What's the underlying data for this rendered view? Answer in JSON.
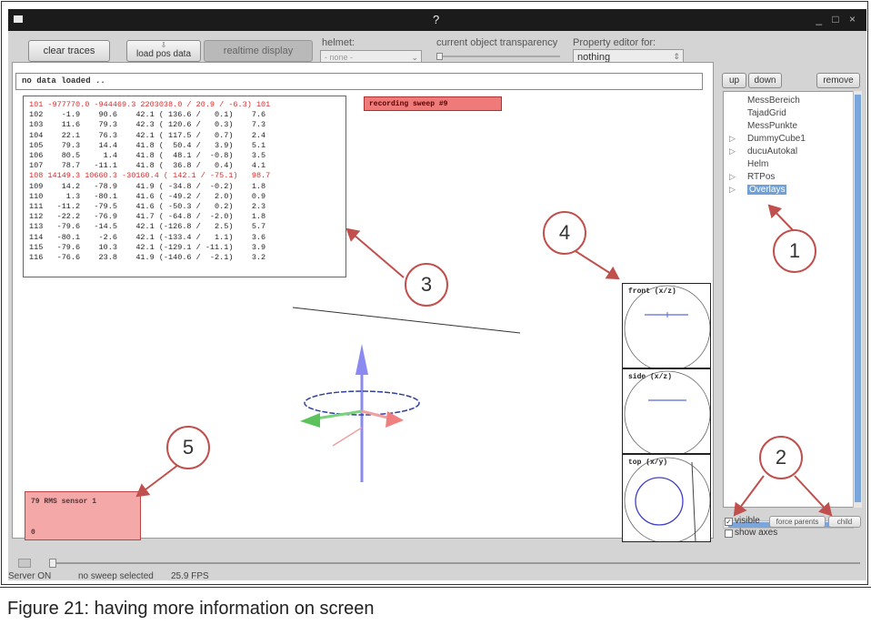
{
  "window": {
    "title": "?",
    "controls": "_ □ ×"
  },
  "toolbar": {
    "clear_traces": "clear traces",
    "load_pos_data": "load pos data",
    "realtime_display": "realtime display",
    "helmet_label": "helmet:",
    "helmet_value": "- none -",
    "transparency_label": "current object transparency",
    "property_editor_label": "Property editor for:",
    "property_editor_value": "nothing"
  },
  "viewport": {
    "message": "no data loaded ..",
    "recording": "recording sweep #9",
    "sensor_label": "79   RMS sensor 1",
    "sensor_value": "0",
    "projections": [
      {
        "title": "front (x/z)"
      },
      {
        "title": "side (x/z)"
      },
      {
        "title": "top (x/y)"
      }
    ],
    "data_rows": [
      {
        "text": "101 -977770.0 -944469.3 2203038.0 / 20.9 / -6.3) 101",
        "highlight": true
      },
      {
        "text": "102    -1.9    90.6    42.1 ( 136.6 /   0.1)    7.6",
        "highlight": false
      },
      {
        "text": "103    11.6    79.3    42.3 ( 120.6 /   0.3)    7.3",
        "highlight": false
      },
      {
        "text": "104    22.1    76.3    42.1 ( 117.5 /   0.7)    2.4",
        "highlight": false
      },
      {
        "text": "105    79.3    14.4    41.8 (  50.4 /   3.9)    5.1",
        "highlight": false
      },
      {
        "text": "106    80.5     1.4    41.8 (  48.1 /  -0.8)    3.5",
        "highlight": false
      },
      {
        "text": "107    78.7   -11.1    41.8 (  36.8 /   0.4)    4.1",
        "highlight": false
      },
      {
        "text": "108 14149.3 10660.3 -30160.4 ( 142.1 / -75.1)   98.7",
        "highlight": true
      },
      {
        "text": "109    14.2   -78.9    41.9 ( -34.8 /  -0.2)    1.8",
        "highlight": false
      },
      {
        "text": "110     1.3   -80.1    41.6 ( -49.2 /   2.0)    0.9",
        "highlight": false
      },
      {
        "text": "111   -11.2   -79.5    41.6 ( -50.3 /   0.2)    2.3",
        "highlight": false
      },
      {
        "text": "112   -22.2   -76.9    41.7 ( -64.8 /  -2.0)    1.8",
        "highlight": false
      },
      {
        "text": "113   -79.6   -14.5    42.1 (-126.8 /   2.5)    5.7",
        "highlight": false
      },
      {
        "text": "114   -80.1    -2.6    42.1 (-133.4 /   1.1)    3.6",
        "highlight": false
      },
      {
        "text": "115   -79.6    10.3    42.1 (-129.1 / -11.1)    3.9",
        "highlight": false
      },
      {
        "text": "116   -76.6    23.8    41.9 (-140.6 /  -2.1)    3.2",
        "highlight": false
      }
    ]
  },
  "tree_panel": {
    "up": "up",
    "down": "down",
    "remove": "remove",
    "items": [
      {
        "label": "MessBereich",
        "expander": ""
      },
      {
        "label": "TajadGrid",
        "expander": ""
      },
      {
        "label": "MessPunkte",
        "expander": ""
      },
      {
        "label": "DummyCube1",
        "expander": "▷"
      },
      {
        "label": "ducuAutokal",
        "expander": "▷"
      },
      {
        "label": "Helm",
        "expander": ""
      },
      {
        "label": "RTPos",
        "expander": "▷"
      },
      {
        "label": "Overlays",
        "expander": "▷",
        "selected": true
      }
    ],
    "visible_label": "visible",
    "force_parents": "force parents",
    "child": "child",
    "show_axes": "show axes"
  },
  "status": {
    "server": "Server ON",
    "sweep": "no sweep selected",
    "fps": "25.9 FPS"
  },
  "callouts": [
    "1",
    "2",
    "3",
    "4",
    "5"
  ],
  "caption": "Figure 21:  having more information on screen",
  "colors": {
    "callout": "#c0504d",
    "selection": "#6fa1d8",
    "recording_bg": "#ef7a7a",
    "sensor_bg": "#f4a8a8"
  }
}
